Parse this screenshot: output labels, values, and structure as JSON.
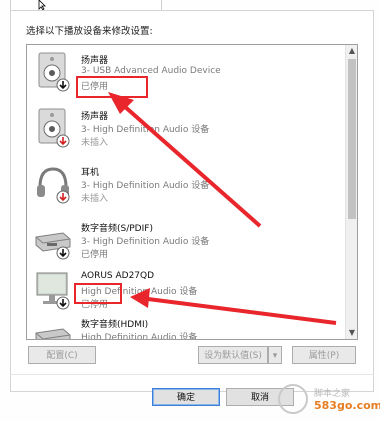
{
  "dialog": {
    "instruction": "选择以下播放设备来修改设置:"
  },
  "devices": [
    {
      "name": "扬声器",
      "description": "3- USB Advanced Audio Device",
      "status": "已停用",
      "icon": "speaker-icon",
      "badge": "down-arrow-black"
    },
    {
      "name": "扬声器",
      "description": "3- High Definition Audio 设备",
      "status": "未插入",
      "icon": "speaker-icon",
      "badge": "down-arrow-red"
    },
    {
      "name": "耳机",
      "description": "3- High Definition Audio 设备",
      "status": "未插入",
      "icon": "headphones-icon",
      "badge": "down-arrow-red"
    },
    {
      "name": "数字音频(S/PDIF)",
      "description": "3- High Definition Audio 设备",
      "status": "已停用",
      "icon": "digital-audio-icon",
      "badge": "down-arrow-black"
    },
    {
      "name": "AORUS AD27QD",
      "description": "High Definition Audio 设备",
      "status": "已停用",
      "icon": "monitor-icon",
      "badge": "down-arrow-black"
    },
    {
      "name": "数字音频(HDMI)",
      "description": "High Definition Audio 设备",
      "status": "",
      "icon": "digital-audio-icon",
      "badge": ""
    }
  ],
  "buttons": {
    "configure": "配置(C)",
    "set_default": "设为默认值(S)",
    "properties": "属性(P)",
    "ok": "确定",
    "cancel": "取消",
    "apply": "应用(A)"
  },
  "watermark": {
    "text": "脚本之家",
    "site": "583go.com"
  },
  "colors": {
    "annotation": "#e8262b",
    "watermark_site": "#e67e22"
  }
}
